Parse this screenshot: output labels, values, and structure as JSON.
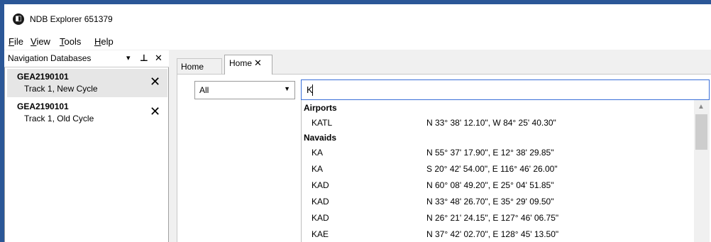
{
  "window": {
    "title": "NDB Explorer 651379",
    "icon": "app-logo-icon",
    "accent": "#2b5797"
  },
  "menu": [
    {
      "underline": "F",
      "rest": "ile"
    },
    {
      "underline": "V",
      "rest": "iew"
    },
    {
      "underline": "T",
      "rest": "ools"
    },
    {
      "underline": "H",
      "rest": "elp"
    }
  ],
  "nav_panel": {
    "title": "Navigation Databases",
    "dropdown_glyph": "▾",
    "pin_glyph": "ᵖ",
    "close_glyph": "✕",
    "items": [
      {
        "name": "GEA2190101",
        "subtitle": "Track 1, New Cycle",
        "remove": "✕"
      },
      {
        "name": "GEA2190101",
        "subtitle": "Track 1, Old Cycle",
        "remove": "✕"
      }
    ]
  },
  "tabs": [
    {
      "label": "Home"
    },
    {
      "label": "Home",
      "close": "✕"
    }
  ],
  "filter": {
    "selected": "All",
    "caret": "▼"
  },
  "search": {
    "value": "K"
  },
  "results": {
    "groups": [
      {
        "header": "Airports",
        "rows": [
          {
            "ident": "KATL",
            "coord": "N 33° 38' 12.10\", W 84° 25' 40.30\""
          }
        ]
      },
      {
        "header": "Navaids",
        "rows": [
          {
            "ident": "KA",
            "coord": "N 55° 37' 17.90\", E 12° 38' 29.85\""
          },
          {
            "ident": "KA",
            "coord": "S 20° 42' 54.00\", E 116° 46' 26.00\""
          },
          {
            "ident": "KAD",
            "coord": "N 60° 08' 49.20\", E 25° 04' 51.85\""
          },
          {
            "ident": "KAD",
            "coord": "N 33° 48' 26.70\", E 35° 29' 09.50\""
          },
          {
            "ident": "KAD",
            "coord": "N 26° 21' 24.15\", E 127° 46' 06.75\""
          },
          {
            "ident": "KAE",
            "coord": "N 37° 42' 02.70\", E 128° 45' 13.50\""
          }
        ]
      }
    ]
  },
  "scrollbar": {
    "up_glyph": "▲"
  }
}
